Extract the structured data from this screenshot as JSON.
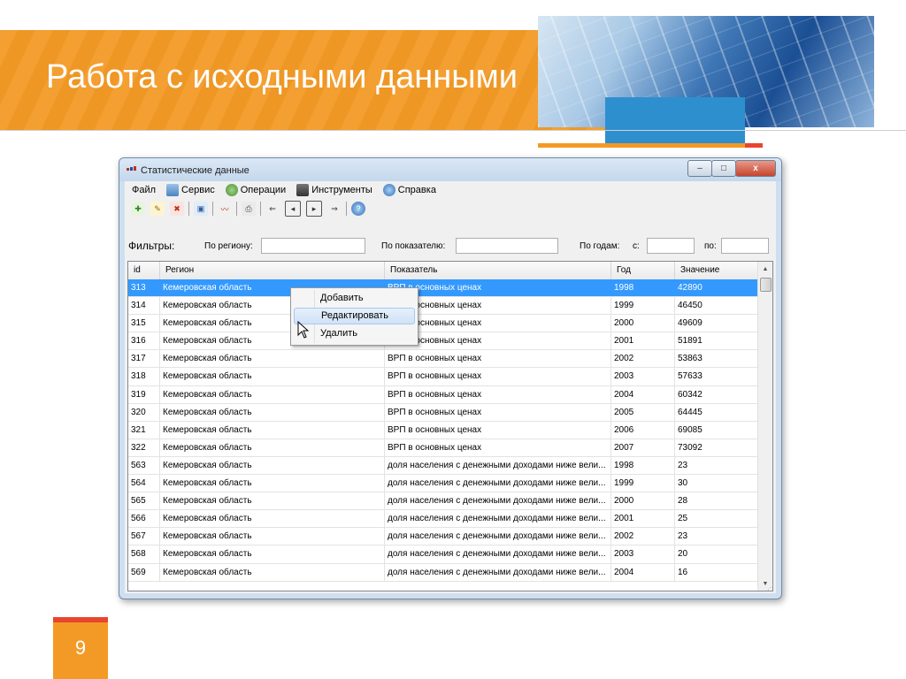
{
  "slide": {
    "title": "Работа с исходными данными",
    "page_number": "9"
  },
  "window": {
    "title": "Статистические данные",
    "controls": {
      "minimize": "–",
      "maximize": "□",
      "close": "x"
    }
  },
  "menu": [
    {
      "label": "Файл",
      "icon": ""
    },
    {
      "label": "Сервис",
      "icon": "service-icon"
    },
    {
      "label": "Операции",
      "icon": "operations-icon"
    },
    {
      "label": "Инструменты",
      "icon": "tools-icon"
    },
    {
      "label": "Справка",
      "icon": "help-icon"
    }
  ],
  "toolbar": {
    "icons": [
      "add-record-icon",
      "edit-record-icon",
      "delete-record-icon",
      "save-icon",
      "chart-icon",
      "print-icon",
      "first-icon",
      "prev-icon",
      "next-icon",
      "last-icon",
      "help-icon"
    ]
  },
  "filters": {
    "title": "Фильтры:",
    "region_label": "По региону:",
    "region_value": "",
    "indicator_label": "По показателю:",
    "indicator_value": "",
    "years_label": "По годам:",
    "from_label": "с:",
    "from_value": "",
    "to_label": "по:",
    "to_value": ""
  },
  "grid": {
    "columns": [
      "id",
      "Регион",
      "Показатель",
      "Год",
      "Значение"
    ],
    "rows": [
      [
        "313",
        "Кемеровская область",
        "ВРП в основных ценах",
        "1998",
        "42890"
      ],
      [
        "314",
        "Кемеровская область",
        "ВРП в основных ценах",
        "1999",
        "46450"
      ],
      [
        "315",
        "Кемеровская область",
        "ВРП в основных ценах",
        "2000",
        "49609"
      ],
      [
        "316",
        "Кемеровская область",
        "ВРП в основных ценах",
        "2001",
        "51891"
      ],
      [
        "317",
        "Кемеровская область",
        "ВРП в основных ценах",
        "2002",
        "53863"
      ],
      [
        "318",
        "Кемеровская область",
        "ВРП в основных ценах",
        "2003",
        "57633"
      ],
      [
        "319",
        "Кемеровская область",
        "ВРП в основных ценах",
        "2004",
        "60342"
      ],
      [
        "320",
        "Кемеровская область",
        "ВРП в основных ценах",
        "2005",
        "64445"
      ],
      [
        "321",
        "Кемеровская область",
        "ВРП в основных ценах",
        "2006",
        "69085"
      ],
      [
        "322",
        "Кемеровская область",
        "ВРП в основных ценах",
        "2007",
        "73092"
      ],
      [
        "563",
        "Кемеровская область",
        "доля населения с денежными доходами ниже вели...",
        "1998",
        "23"
      ],
      [
        "564",
        "Кемеровская область",
        "доля населения с денежными доходами ниже вели...",
        "1999",
        "30"
      ],
      [
        "565",
        "Кемеровская область",
        "доля населения с денежными доходами ниже вели...",
        "2000",
        "28"
      ],
      [
        "566",
        "Кемеровская область",
        "доля населения с денежными доходами ниже вели...",
        "2001",
        "25"
      ],
      [
        "567",
        "Кемеровская область",
        "доля населения с денежными доходами ниже вели...",
        "2002",
        "23"
      ],
      [
        "568",
        "Кемеровская область",
        "доля населения с денежными доходами ниже вели...",
        "2003",
        "20"
      ],
      [
        "569",
        "Кемеровская область",
        "доля населения с денежными доходами ниже вели...",
        "2004",
        "16"
      ]
    ],
    "selected_row": 0
  },
  "context_menu": {
    "items": [
      "Добавить",
      "Редактировать",
      "Удалить"
    ],
    "highlighted": 1
  },
  "colors": {
    "accent_orange": "#f39a26",
    "accent_blue": "#2e8fcf",
    "accent_red": "#e8452e",
    "selection": "#3399ff"
  }
}
